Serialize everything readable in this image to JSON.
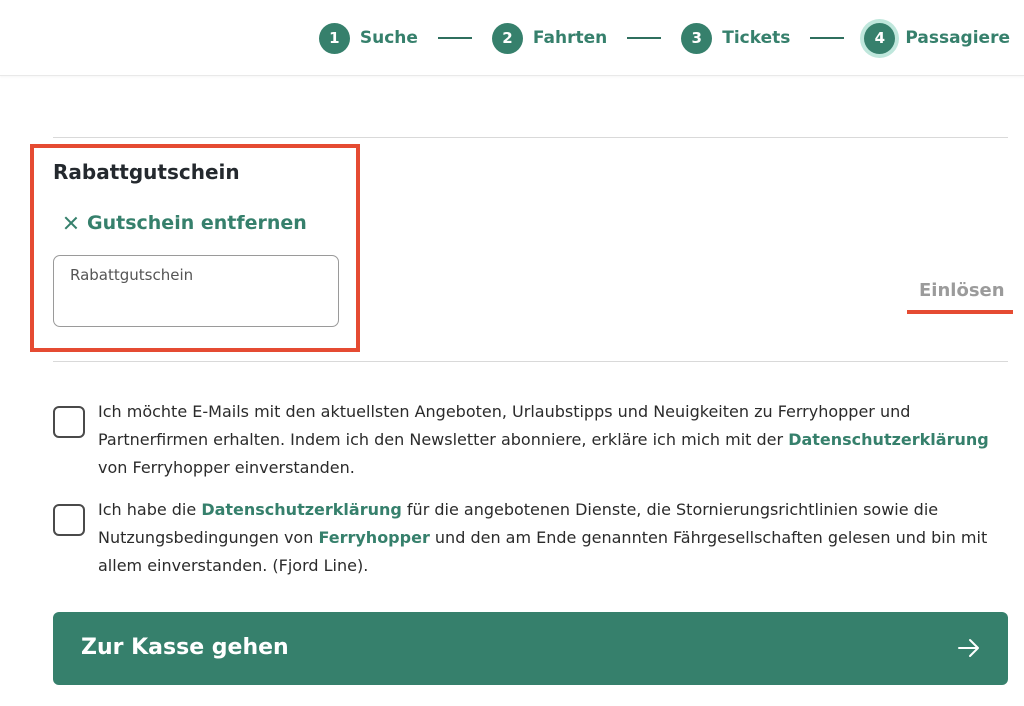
{
  "stepper": {
    "steps": [
      {
        "num": "1",
        "label": "Suche"
      },
      {
        "num": "2",
        "label": "Fahrten"
      },
      {
        "num": "3",
        "label": "Tickets"
      },
      {
        "num": "4",
        "label": "Passagiere"
      }
    ],
    "active_step": 4
  },
  "voucher": {
    "title": "Rabattgutschein",
    "remove_label": "Gutschein entfernen",
    "input_placeholder": "Rabattgutschein",
    "input_value": "",
    "redeem_label": "Einlösen"
  },
  "consents": {
    "newsletter": {
      "checked": false,
      "text_before": "Ich möchte E-Mails mit den aktuellsten Angeboten, Urlaubstipps und Neuigkeiten zu Ferryhopper und Partnerfirmen erhalten. Indem ich den Newsletter abonniere, erkläre ich mich mit der ",
      "link": "Datenschutzerklärung",
      "text_after": " von Ferryhopper einverstanden."
    },
    "terms": {
      "checked": false,
      "text_1": "Ich habe die ",
      "link_1": "Datenschutzerklärung",
      "text_2": " für die angebotenen Dienste, die Stornierungsrichtlinien sowie die Nutzungsbedingungen von ",
      "link_2": "Ferryhopper",
      "text_3": " und den am Ende genannten Fährgesellschaften gelesen und bin mit allem einverstanden. (Fjord Line)."
    }
  },
  "cta": {
    "label": "Zur Kasse gehen",
    "icon": "arrow-right-icon"
  },
  "colors": {
    "brand_green": "#36806c",
    "highlight_red": "#e54b32",
    "active_ring": "#bfe7dc"
  }
}
